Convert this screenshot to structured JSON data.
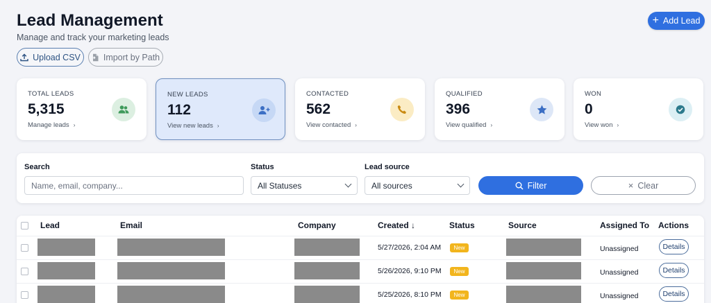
{
  "header": {
    "title": "Lead Management",
    "subtitle": "Manage and track your marketing leads",
    "add_label": "Add Lead",
    "upload_label": "Upload CSV",
    "import_label": "Import by Path"
  },
  "stats": [
    {
      "label": "TOTAL LEADS",
      "value": "5,315",
      "link": "Manage leads",
      "icon": "users-icon",
      "icon_bg": "#dcefe1",
      "icon_color": "#3f9a5b"
    },
    {
      "label": "NEW LEADS",
      "value": "112",
      "link": "View new leads",
      "icon": "user-plus-icon",
      "icon_bg": "#c6d8f5",
      "icon_color": "#3c6fc4"
    },
    {
      "label": "CONTACTED",
      "value": "562",
      "link": "View contacted",
      "icon": "phone-icon",
      "icon_bg": "#fbecc4",
      "icon_color": "#c98a12"
    },
    {
      "label": "QUALIFIED",
      "value": "396",
      "link": "View qualified",
      "icon": "star-icon",
      "icon_bg": "#dde7f7",
      "icon_color": "#3c6fc4"
    },
    {
      "label": "WON",
      "value": "0",
      "link": "View won",
      "icon": "check-circle-icon",
      "icon_bg": "#dceff4",
      "icon_color": "#2c7a8c"
    }
  ],
  "filters": {
    "search_label": "Search",
    "search_placeholder": "Name, email, company...",
    "status_label": "Status",
    "status_value": "All Statuses",
    "source_label": "Lead source",
    "source_value": "All sources",
    "filter_label": "Filter",
    "clear_label": "Clear"
  },
  "table": {
    "columns": {
      "lead": "Lead",
      "email": "Email",
      "company": "Company",
      "created": "Created ↓",
      "status": "Status",
      "source": "Source",
      "assigned": "Assigned To",
      "actions": "Actions"
    },
    "rows": [
      {
        "created": "5/27/2026, 2:04 AM",
        "status": "New",
        "assigned": "Unassigned",
        "action": "Details"
      },
      {
        "created": "5/26/2026, 9:10 PM",
        "status": "New",
        "assigned": "Unassigned",
        "action": "Details"
      },
      {
        "created": "5/25/2026, 8:10 PM",
        "status": "New",
        "assigned": "Unassigned",
        "action": "Details"
      }
    ]
  },
  "colors": {
    "accent": "#2f6fe0",
    "badge_new": "#f2b51d",
    "redacted": "#8a8a8a"
  }
}
